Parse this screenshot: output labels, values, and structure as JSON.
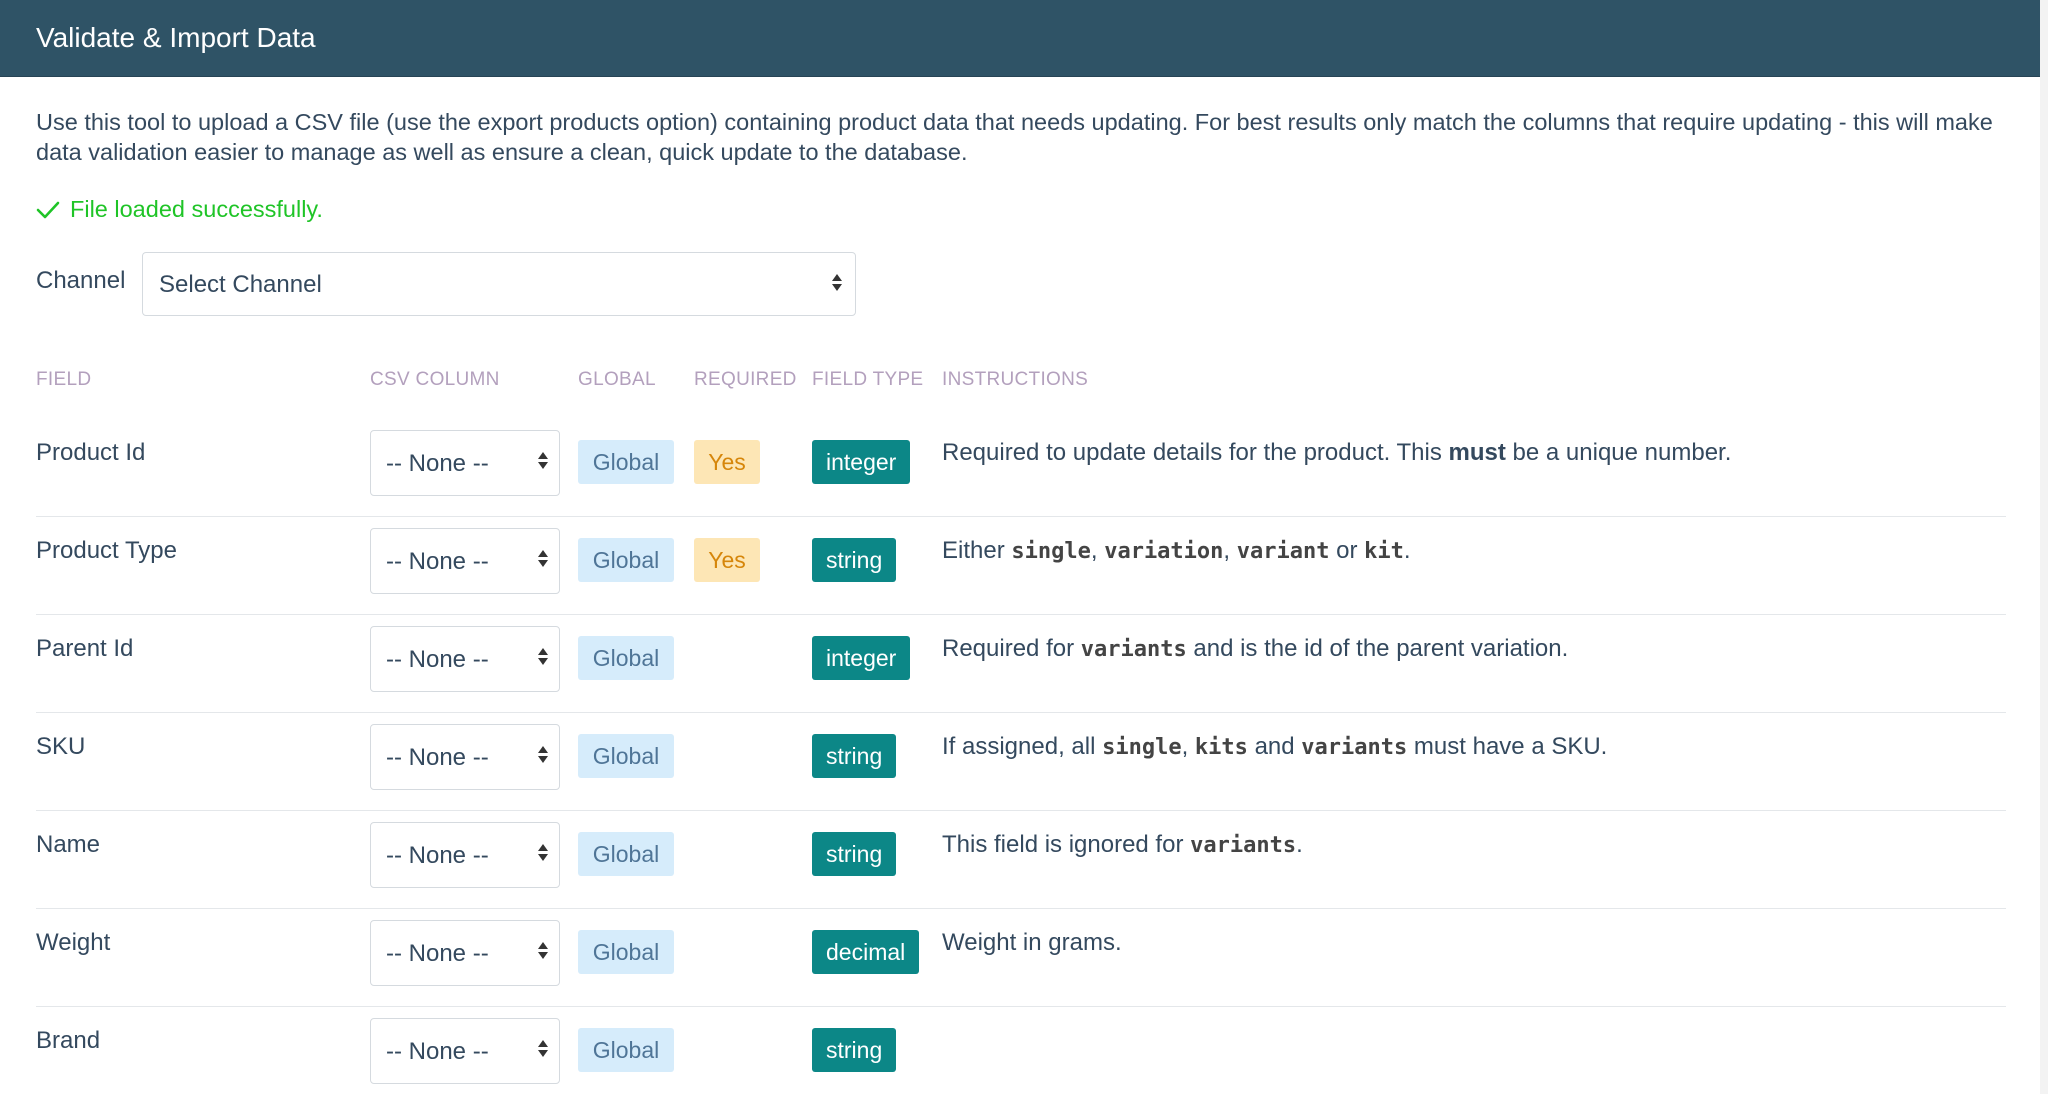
{
  "header": {
    "title": "Validate & Import Data"
  },
  "intro": "Use this tool to upload a CSV file (use the export products option) containing product data that needs updating. For best results only match the columns that require updating - this will make data validation easier to manage as well as ensure a clean, quick update to the database.",
  "status": {
    "message": "File loaded successfully.",
    "color": "#1fc427",
    "icon": "check-icon"
  },
  "channel": {
    "label": "Channel",
    "selected": "Select Channel"
  },
  "table": {
    "headers": {
      "field": "FIELD",
      "csv_column": "CSV COLUMN",
      "global": "GLOBAL",
      "required": "REQUIRED",
      "field_type": "FIELD TYPE",
      "instructions": "INSTRUCTIONS"
    },
    "rows": [
      {
        "field": "Product Id",
        "csv_column": "-- None --",
        "global": "Global",
        "required": "Yes",
        "type": "integer",
        "instructions": [
          {
            "t": "Required to update details for the product. This "
          },
          {
            "t": "must",
            "s": "b"
          },
          {
            "t": " be a unique number."
          }
        ]
      },
      {
        "field": "Product Type",
        "csv_column": "-- None --",
        "global": "Global",
        "required": "Yes",
        "type": "string",
        "instructions": [
          {
            "t": "Either "
          },
          {
            "t": "single",
            "s": "code"
          },
          {
            "t": ", "
          },
          {
            "t": "variation",
            "s": "code"
          },
          {
            "t": ", "
          },
          {
            "t": "variant",
            "s": "code"
          },
          {
            "t": " or "
          },
          {
            "t": "kit",
            "s": "code"
          },
          {
            "t": "."
          }
        ]
      },
      {
        "field": "Parent Id",
        "csv_column": "-- None --",
        "global": "Global",
        "required": "",
        "type": "integer",
        "instructions": [
          {
            "t": "Required for "
          },
          {
            "t": "variants",
            "s": "code"
          },
          {
            "t": " and is the id of the parent variation."
          }
        ]
      },
      {
        "field": "SKU",
        "csv_column": "-- None --",
        "global": "Global",
        "required": "",
        "type": "string",
        "instructions": [
          {
            "t": "If assigned, all "
          },
          {
            "t": "single",
            "s": "code"
          },
          {
            "t": ", "
          },
          {
            "t": "kits",
            "s": "code"
          },
          {
            "t": " and "
          },
          {
            "t": "variants",
            "s": "code"
          },
          {
            "t": " must have a SKU."
          }
        ]
      },
      {
        "field": "Name",
        "csv_column": "-- None --",
        "global": "Global",
        "required": "",
        "type": "string",
        "instructions": [
          {
            "t": "This field is ignored for "
          },
          {
            "t": "variants",
            "s": "code"
          },
          {
            "t": "."
          }
        ]
      },
      {
        "field": "Weight",
        "csv_column": "-- None --",
        "global": "Global",
        "required": "",
        "type": "decimal",
        "instructions": [
          {
            "t": "Weight in grams."
          }
        ]
      },
      {
        "field": "Brand",
        "csv_column": "-- None --",
        "global": "Global",
        "required": "",
        "type": "string",
        "instructions": []
      }
    ]
  },
  "colors": {
    "header_bg": "#2f5366",
    "success": "#1fc427",
    "global_badge_bg": "#d6ecfb",
    "global_badge_text": "#4f7597",
    "yes_badge_bg": "#fde6b5",
    "yes_badge_text": "#d6860a",
    "type_badge_bg": "#0c8787",
    "table_header_text": "#b3a0bd"
  }
}
